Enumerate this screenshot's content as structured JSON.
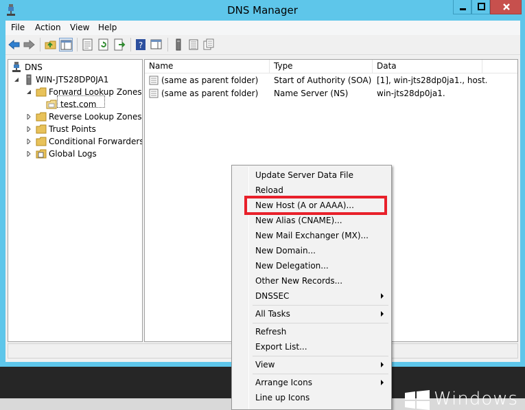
{
  "window": {
    "title": "DNS Manager"
  },
  "menu": [
    "File",
    "Action",
    "View",
    "Help"
  ],
  "tree": {
    "root": "DNS",
    "server": "WIN-JTS28DP0JA1",
    "forward_zones": "Forward Lookup Zones",
    "zone": "test.com",
    "reverse_zones": "Reverse Lookup Zones",
    "trust_points": "Trust Points",
    "conditional_forwarders": "Conditional Forwarders",
    "global_logs": "Global Logs"
  },
  "list": {
    "columns": [
      "Name",
      "Type",
      "Data"
    ],
    "rows": [
      {
        "name": "(same as parent folder)",
        "type": "Start of Authority (SOA)",
        "data": "[1], win-jts28dp0ja1., host..."
      },
      {
        "name": "(same as parent folder)",
        "type": "Name Server (NS)",
        "data": "win-jts28dp0ja1."
      }
    ]
  },
  "context_menu": {
    "items": [
      "Update Server Data File",
      "Reload",
      "New Host (A or AAAA)...",
      "New Alias (CNAME)...",
      "New Mail Exchanger (MX)...",
      "New Domain...",
      "New Delegation...",
      "Other New Records...",
      "DNSSEC",
      "All Tasks",
      "Refresh",
      "Export List...",
      "View",
      "Arrange Icons",
      "Line up Icons"
    ],
    "highlighted_item": "New Host (A or AAAA)..."
  },
  "desktop": {
    "brand": "Windows"
  },
  "colors": {
    "titlebar": "#5ec6ea",
    "close_button": "#c7504d",
    "highlight_box": "#e8202a",
    "folder": "#e8c25a"
  }
}
